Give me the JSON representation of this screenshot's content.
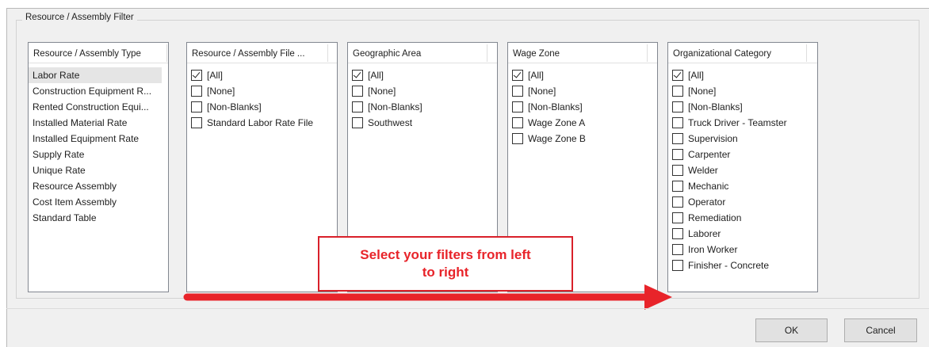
{
  "group_title": "Resource / Assembly Filter",
  "lists": {
    "resource_type": {
      "header": "Resource / Assembly Type",
      "items": [
        "Labor Rate",
        "Construction Equipment R...",
        "Rented Construction Equi...",
        "Installed Material Rate",
        "Installed Equipment Rate",
        "Supply Rate",
        "Unique Rate",
        "Resource Assembly",
        "Cost Item Assembly",
        "Standard Table"
      ],
      "selected": "Labor Rate"
    },
    "file": {
      "header": "Resource / Assembly File ...",
      "items": [
        {
          "label": "[All]",
          "checked": true
        },
        {
          "label": "[None]",
          "checked": false
        },
        {
          "label": "[Non-Blanks]",
          "checked": false
        },
        {
          "label": "Standard Labor Rate File",
          "checked": false
        }
      ]
    },
    "geo": {
      "header": "Geographic Area",
      "items": [
        {
          "label": "[All]",
          "checked": true
        },
        {
          "label": "[None]",
          "checked": false
        },
        {
          "label": "[Non-Blanks]",
          "checked": false
        },
        {
          "label": "Southwest",
          "checked": false
        }
      ]
    },
    "wage": {
      "header": "Wage Zone",
      "items": [
        {
          "label": "[All]",
          "checked": true
        },
        {
          "label": "[None]",
          "checked": false
        },
        {
          "label": "[Non-Blanks]",
          "checked": false
        },
        {
          "label": "Wage Zone A",
          "checked": false
        },
        {
          "label": "Wage Zone B",
          "checked": false
        }
      ]
    },
    "org": {
      "header": "Organizational Category",
      "items": [
        {
          "label": "[All]",
          "checked": true
        },
        {
          "label": "[None]",
          "checked": false
        },
        {
          "label": "[Non-Blanks]",
          "checked": false
        },
        {
          "label": "Truck Driver - Teamster",
          "checked": false
        },
        {
          "label": "Supervision",
          "checked": false
        },
        {
          "label": "Carpenter",
          "checked": false
        },
        {
          "label": "Welder",
          "checked": false
        },
        {
          "label": "Mechanic",
          "checked": false
        },
        {
          "label": "Operator",
          "checked": false
        },
        {
          "label": "Remediation",
          "checked": false
        },
        {
          "label": "Laborer",
          "checked": false
        },
        {
          "label": "Iron Worker",
          "checked": false
        },
        {
          "label": "Finisher - Concrete",
          "checked": false
        }
      ]
    }
  },
  "buttons": {
    "ok": "OK",
    "cancel": "Cancel"
  },
  "annotation": {
    "text": "Select your filters from left to right",
    "color": "#e8242a"
  }
}
